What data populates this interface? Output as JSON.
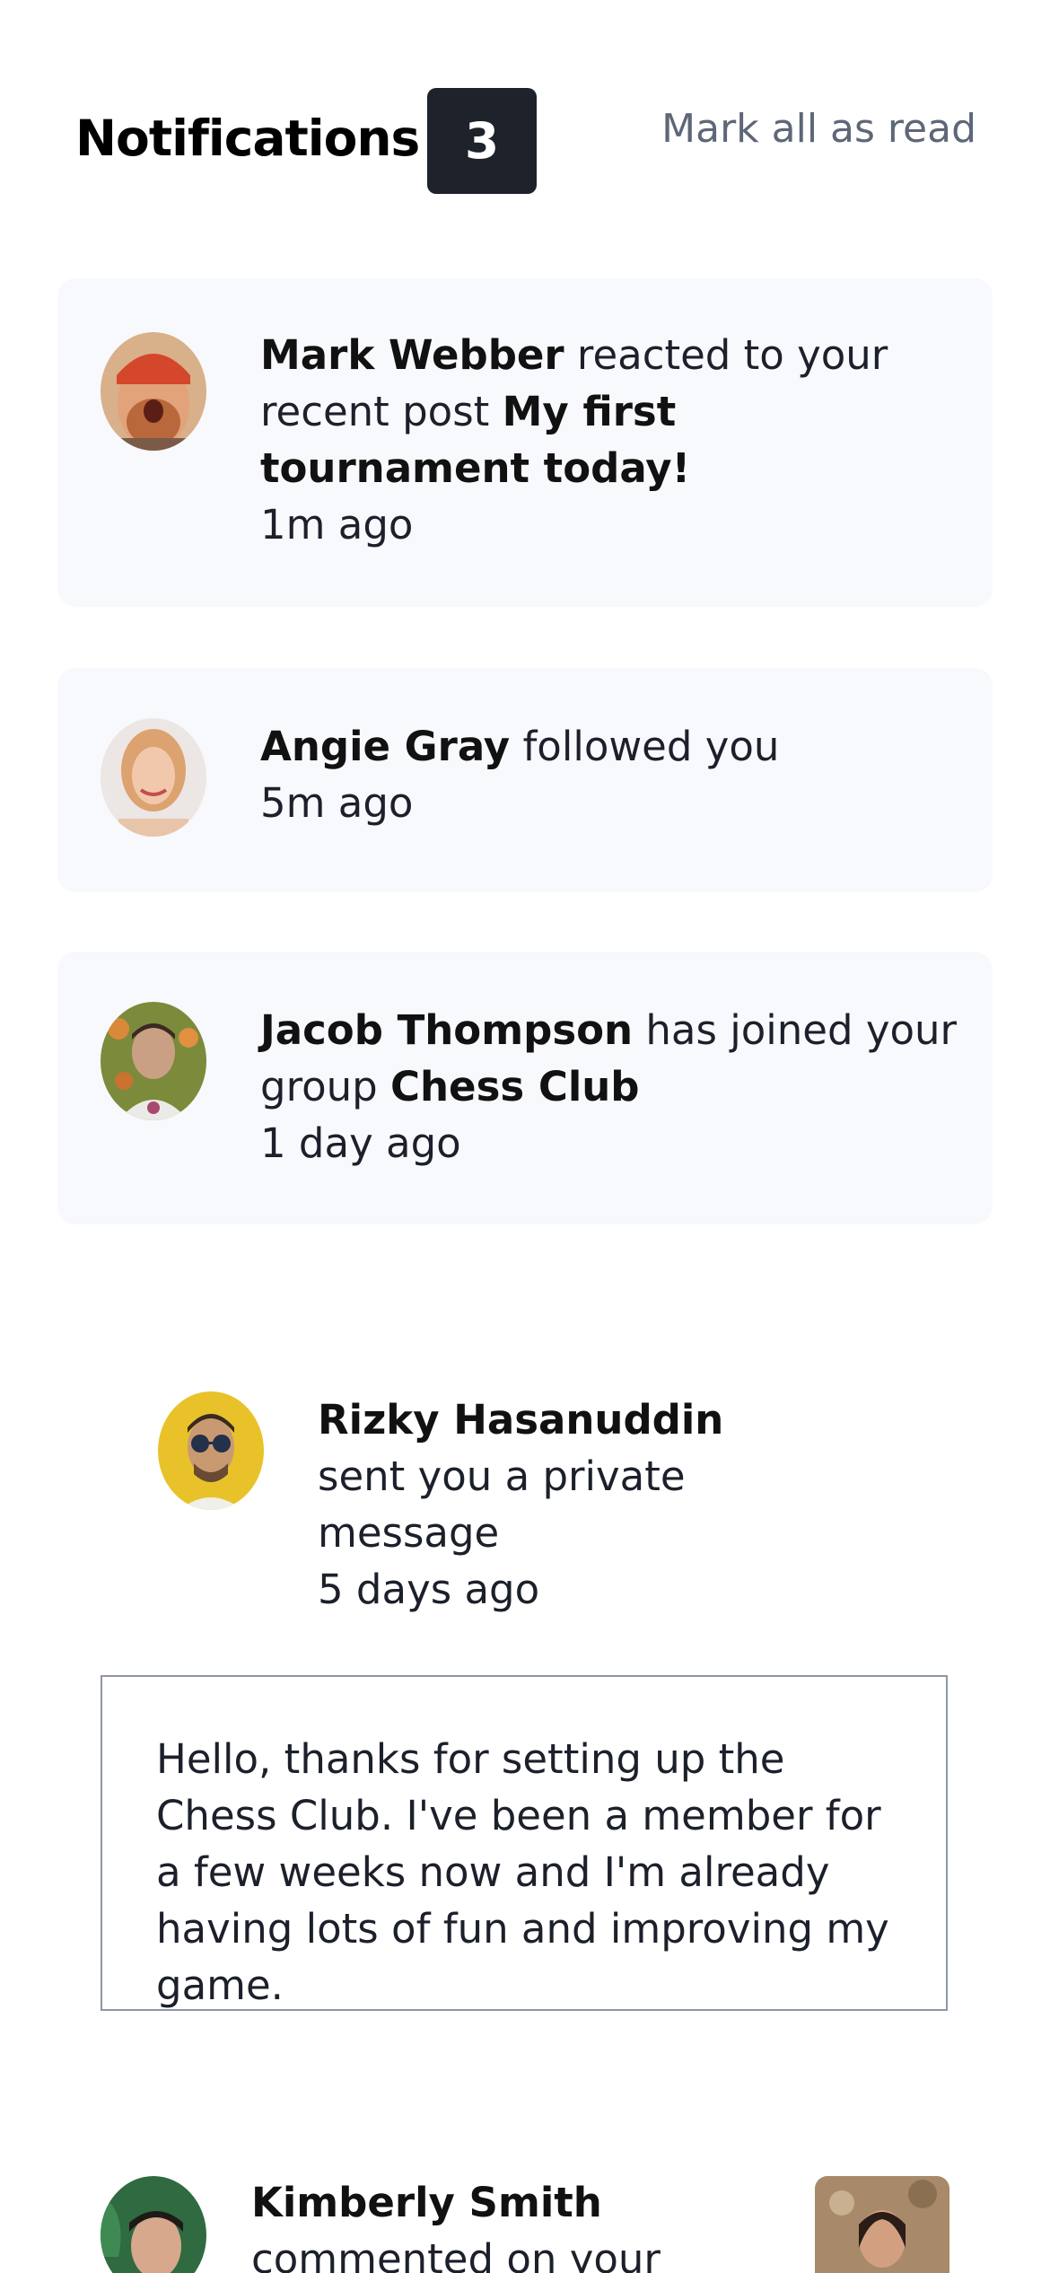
{
  "header": {
    "title": "Notifications",
    "unread_count": "3",
    "mark_all_label": "Mark all as read"
  },
  "notifications": [
    {
      "name": "Mark Webber",
      "action": " reacted to your recent post ",
      "target": "My first tournament today!",
      "time": "1m ago",
      "avatar_icon": "avatar-mark-webber"
    },
    {
      "name": "Angie Gray",
      "action": " followed you",
      "time": "5m ago",
      "avatar_icon": "avatar-angie-gray"
    },
    {
      "name": "Jacob Thompson",
      "action": " has joined your group ",
      "target": "Chess Club",
      "time": "1 day ago",
      "avatar_icon": "avatar-jacob-thompson"
    },
    {
      "name": "Rizky Hasanuddin",
      "action": " sent you a private message",
      "time": "5 days ago",
      "message": "Hello, thanks for setting up the Chess Club. I've been a member for a few weeks now and I'm already having lots of fun and improving my game.",
      "avatar_icon": "avatar-rizky-hasanuddin"
    },
    {
      "name": "Kimberly Smith",
      "action": "commented on your",
      "avatar_icon": "avatar-kimberly-smith",
      "thumbnail_icon": "chess-picture-thumbnail"
    }
  ],
  "colors": {
    "badge_bg": "#1e222b",
    "card_bg": "#f7f9fc",
    "muted_text": "#5e6778",
    "message_border": "#8e96a6"
  }
}
